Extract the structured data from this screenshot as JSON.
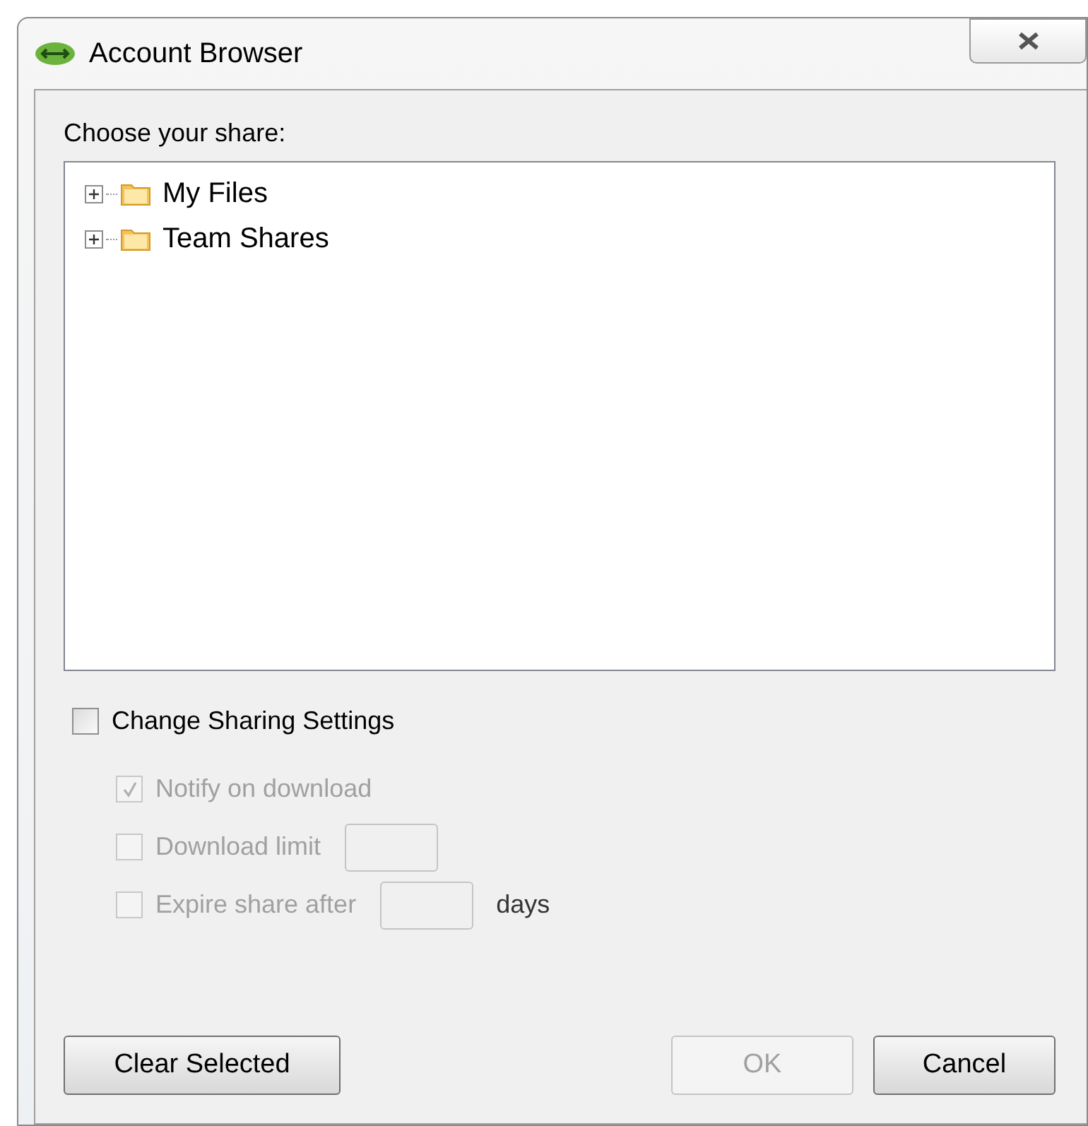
{
  "window": {
    "title": "Account Browser"
  },
  "share_label": "Choose your share:",
  "tree": [
    {
      "label": "My Files",
      "expanded": false
    },
    {
      "label": "Team Shares",
      "expanded": false
    }
  ],
  "change_sharing": {
    "label": "Change Sharing Settings",
    "checked": false
  },
  "options": [
    {
      "kind": "check",
      "label": "Notify on download",
      "checked": true,
      "disabled": true
    },
    {
      "kind": "field",
      "label": "Download limit",
      "checked": false,
      "disabled": true
    },
    {
      "kind": "field",
      "label": "Expire share after",
      "checked": false,
      "disabled": true,
      "suffix": "days"
    }
  ],
  "buttons": [
    {
      "label": "Clear Selected",
      "disabled": false
    },
    {
      "label": "OK",
      "disabled": true
    },
    {
      "label": "Cancel",
      "disabled": false
    }
  ]
}
